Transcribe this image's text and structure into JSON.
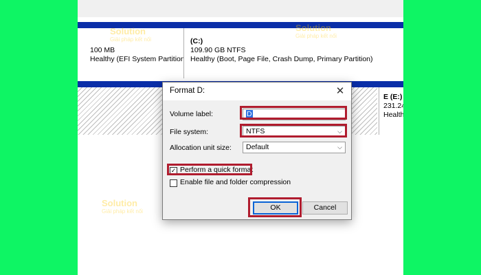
{
  "disks": {
    "row1": {
      "efi": {
        "size": "100 MB",
        "status": "Healthy (EFI System Partition"
      },
      "c": {
        "name": "(C:)",
        "size": "109.90 GB NTFS",
        "status": "Healthy (Boot, Page File, Crash Dump, Primary Partition)"
      }
    },
    "row2": {
      "e": {
        "name": "E (E:)",
        "size": "231.24",
        "status": "Health"
      }
    }
  },
  "watermark": {
    "brand": "Solution",
    "tagline": "Giải pháp kết nối"
  },
  "dialog": {
    "title": "Format D:",
    "close_glyph": "✕",
    "volume_label": {
      "label": "Volume label:",
      "value": "D"
    },
    "file_system": {
      "label": "File system:",
      "value": "NTFS",
      "chevron": "⌵"
    },
    "allocation": {
      "label": "Allocation unit size:",
      "value": "Default",
      "chevron": "⌵"
    },
    "quick_format": {
      "label": "Perform a quick format",
      "checked": true
    },
    "compression": {
      "label": "Enable file and folder compression",
      "checked": false
    },
    "ok_label": "OK",
    "cancel_label": "Cancel"
  },
  "colors": {
    "background": "#0ef564",
    "partition_bar": "#0a2ea8",
    "highlight": "#b01c2e",
    "focus": "#0a64d6"
  }
}
